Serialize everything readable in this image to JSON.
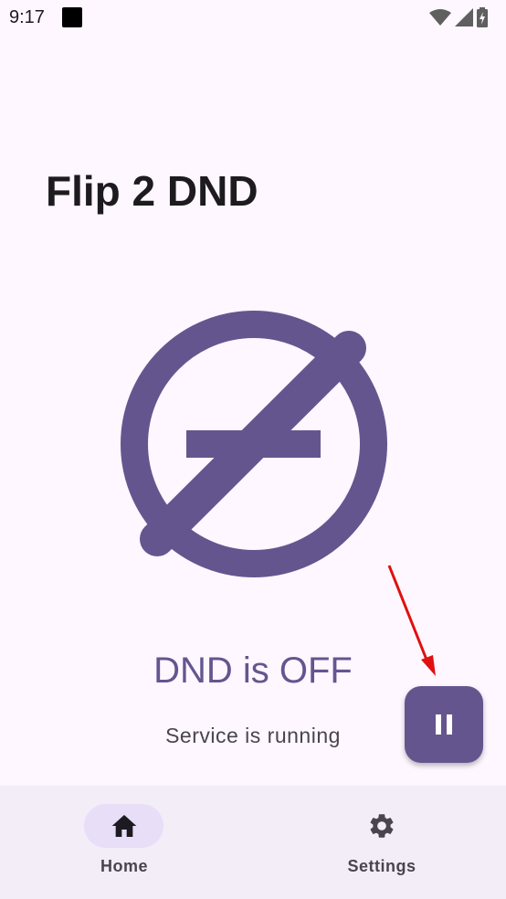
{
  "status_bar": {
    "time": "9:17"
  },
  "app": {
    "title": "Flip 2 DND"
  },
  "main": {
    "dnd_status": "DND is OFF",
    "service_status": "Service is running"
  },
  "fab": {
    "icon": "pause-icon"
  },
  "bottom_nav": {
    "items": [
      {
        "label": "Home",
        "icon": "home-icon",
        "selected": true
      },
      {
        "label": "Settings",
        "icon": "gear-icon",
        "selected": false
      }
    ]
  },
  "colors": {
    "primary": "#65558F",
    "background": "#FEF7FF",
    "nav_background": "#F3EDF7",
    "nav_indicator": "#E8DEF8",
    "annotation_arrow": "#E01010"
  }
}
